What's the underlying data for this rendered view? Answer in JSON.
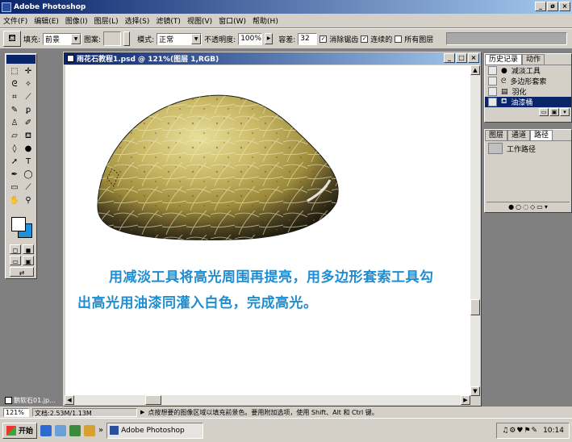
{
  "app": {
    "title": "Adobe Photoshop",
    "window_buttons": [
      "_",
      "ø",
      "×"
    ]
  },
  "menu": [
    "文件(F)",
    "编辑(E)",
    "图像(I)",
    "图层(L)",
    "选择(S)",
    "滤镜(T)",
    "视图(V)",
    "窗口(W)",
    "帮助(H)"
  ],
  "options": {
    "fill_label": "填充:",
    "fill_value": "前景",
    "pattern_label": "图案:",
    "mode_label": "模式:",
    "mode_value": "正常",
    "opacity_label": "不透明度:",
    "opacity_value": "100%",
    "tolerance_label": "容差:",
    "tolerance_value": "32",
    "antialias_label": "消除锯齿",
    "contiguous_label": "连续的",
    "all_layers_label": "所有图层"
  },
  "document": {
    "title": "雨花石教程1.psd @ 121%(图层 1,RGB)",
    "caption_line1": "用减淡工具将高光周围再提亮，用多边形套索工具勾",
    "caption_line2": "出高光用油漆同灌入白色，完成高光。"
  },
  "history_palette": {
    "tabs": [
      "历史记录",
      "动作"
    ],
    "items": [
      {
        "label": "减淡工具",
        "selected": false
      },
      {
        "label": "多边形套索",
        "selected": false
      },
      {
        "label": "羽化",
        "selected": false
      },
      {
        "label": "油漆桶",
        "selected": true
      }
    ]
  },
  "paths_palette": {
    "tabs": [
      "图层",
      "通道",
      "路径"
    ],
    "items": [
      "工作路径"
    ]
  },
  "minimized_doc": {
    "label": "鹅软石01.jp..."
  },
  "status": {
    "zoom": "121%",
    "doc_size": "文档:2.53M/1.13M",
    "hint": "点按想要的图像区域以填充前景色。要用附加选项，使用 Shift、Alt 和 Ctrl 键。"
  },
  "taskbar": {
    "start_label": "开始",
    "app_label": "Adobe Photoshop",
    "clock": "10:14"
  },
  "colors": {
    "caption": "#1e8dd2",
    "titlebar_start": "#0a246a",
    "titlebar_end": "#a6caf0",
    "chrome": "#d4d0c8"
  }
}
